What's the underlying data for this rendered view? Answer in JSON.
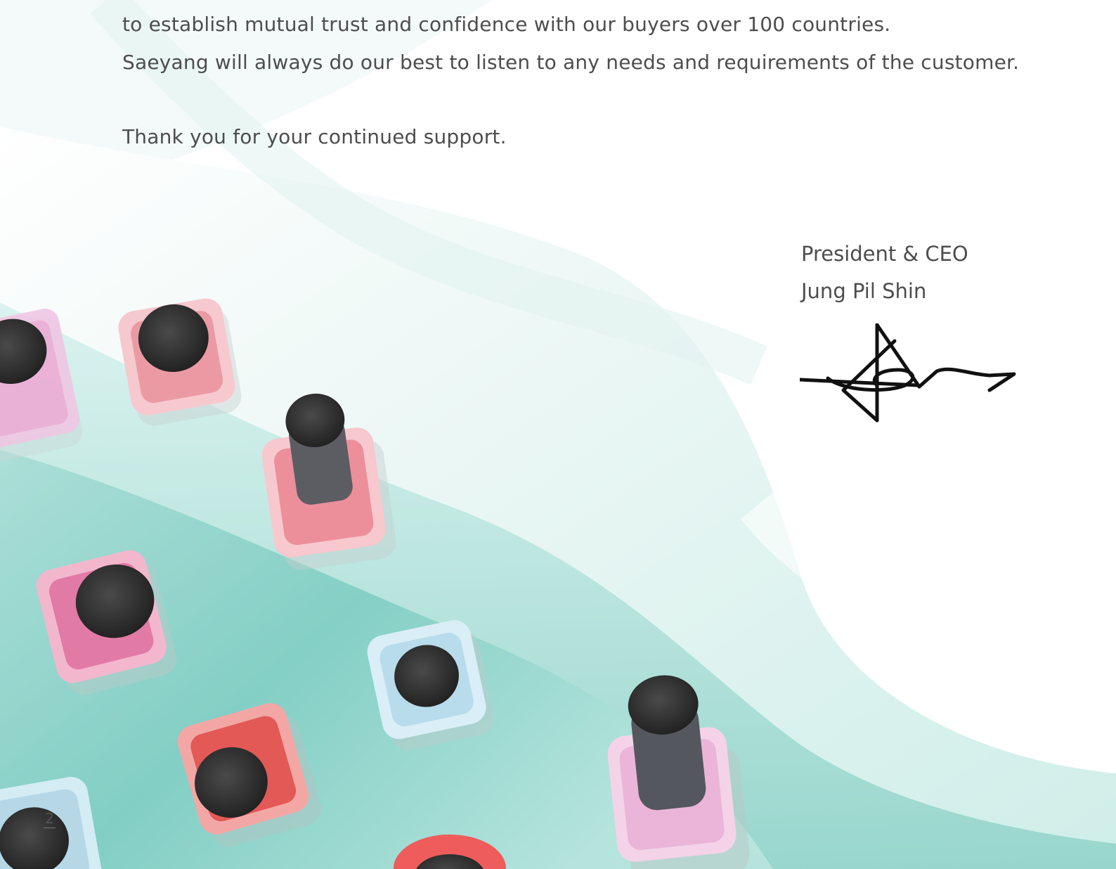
{
  "letter": {
    "line_partial": "to establish  mutual trust and confidence with our buyers over 100 countries.",
    "line_promise": "Saeyang will always do our best to listen to any needs and requirements of the customer.",
    "line_thanks": "Thank you for your continued support."
  },
  "signatory": {
    "title": "President & CEO",
    "name": "Jung Pil Shin"
  },
  "page_number": "2",
  "illustration": {
    "subject": "nail-polish-bottles-on-silk",
    "colors": {
      "teal_silk": "#8fd3cb",
      "light_silk": "#dff3f0",
      "cap": "#2f2f2f",
      "pink": "#f2a9b5",
      "rose": "#e27d8b",
      "magenta": "#e58fb2",
      "blue": "#bfe0ee",
      "red": "#e85a5a",
      "lilac": "#efc7e3"
    }
  }
}
